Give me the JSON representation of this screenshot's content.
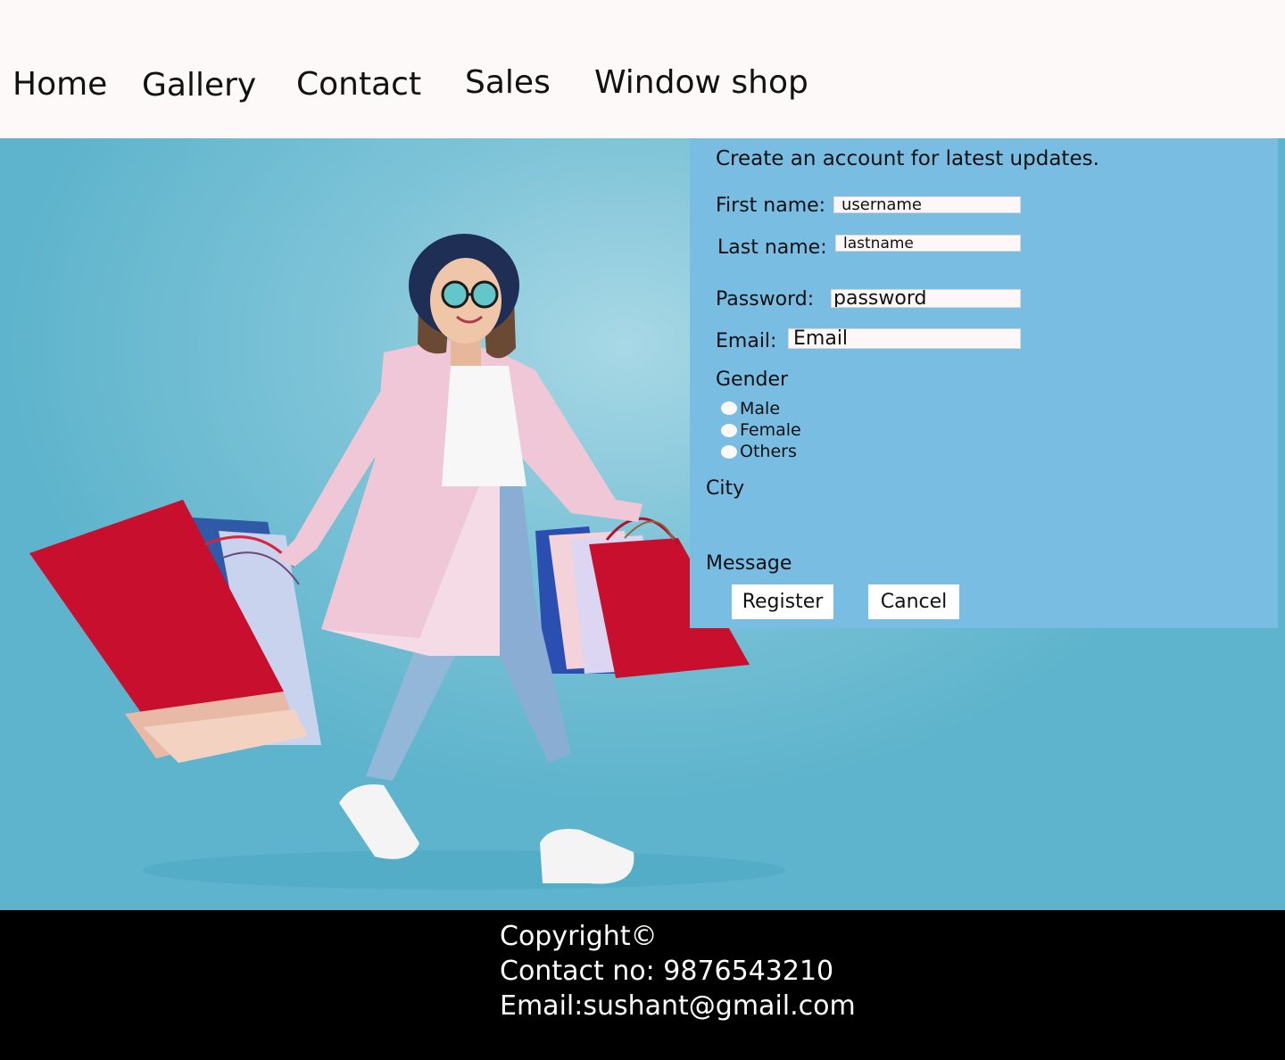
{
  "nav": {
    "home": "Home",
    "gallery": "Gallery",
    "contact": "Contact",
    "sales": "Sales",
    "window_shop": "Window shop"
  },
  "form": {
    "heading": "Create an account for latest updates.",
    "first_name_label": "First name:",
    "first_name_placeholder": "username",
    "last_name_label": "Last name:",
    "last_name_placeholder": "lastname",
    "password_label": "Password:",
    "password_placeholder": "password",
    "email_label": "Email:",
    "email_placeholder": "Email",
    "gender_label": "Gender",
    "gender_options": [
      "Male",
      "Female",
      "Others"
    ],
    "city_label": "City",
    "message_label": "Message",
    "register_label": "Register",
    "cancel_label": "Cancel"
  },
  "footer": {
    "copyright": "Copyright©",
    "contact": "Contact no: 9876543210",
    "email": "Email:sushant@gmail.com"
  },
  "colors": {
    "header_bg": "#fdf9f8",
    "form_panel_bg": "#7abde3",
    "hero_bg": "#7fc4d8",
    "footer_bg": "#000000"
  }
}
